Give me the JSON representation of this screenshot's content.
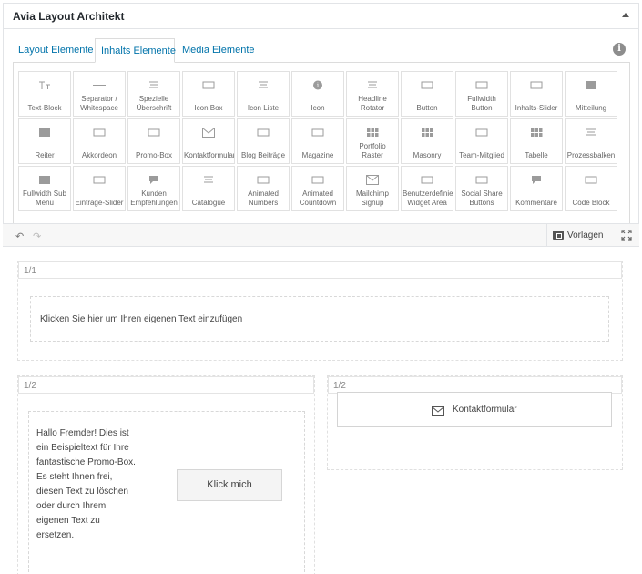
{
  "panel": {
    "title": "Avia Layout Architekt"
  },
  "tabs": [
    {
      "label": "Layout Elemente",
      "active": false
    },
    {
      "label": "Inhalts Elemente",
      "active": true
    },
    {
      "label": "Media Elemente",
      "active": false
    }
  ],
  "elements": [
    {
      "label": "Text-Block",
      "icon": "text-block-icon"
    },
    {
      "label": "Separator / Whitespace",
      "icon": "separator-icon"
    },
    {
      "label": "Spezielle Überschrift",
      "icon": "heading-icon"
    },
    {
      "label": "Icon Box",
      "icon": "icon-box-icon"
    },
    {
      "label": "Icon Liste",
      "icon": "icon-list-icon"
    },
    {
      "label": "Icon",
      "icon": "info-icon"
    },
    {
      "label": "Headline Rotator",
      "icon": "headline-rotator-icon"
    },
    {
      "label": "Button",
      "icon": "button-icon"
    },
    {
      "label": "Fullwidth Button",
      "icon": "fullwidth-button-icon"
    },
    {
      "label": "Inhalts-Slider",
      "icon": "content-slider-icon"
    },
    {
      "label": "Mitteilung",
      "icon": "notification-icon"
    },
    {
      "label": "Reiter",
      "icon": "tabs-icon"
    },
    {
      "label": "Akkordeon",
      "icon": "accordion-icon"
    },
    {
      "label": "Promo-Box",
      "icon": "promo-box-icon"
    },
    {
      "label": "Kontaktformular",
      "icon": "envelope-icon"
    },
    {
      "label": "Blog Beiträge",
      "icon": "blog-posts-icon"
    },
    {
      "label": "Magazine",
      "icon": "magazine-icon"
    },
    {
      "label": "Portfolio Raster",
      "icon": "portfolio-grid-icon"
    },
    {
      "label": "Masonry",
      "icon": "masonry-icon"
    },
    {
      "label": "Team-Mitglied",
      "icon": "team-member-icon"
    },
    {
      "label": "Tabelle",
      "icon": "table-icon"
    },
    {
      "label": "Prozessbalken",
      "icon": "process-bars-icon"
    },
    {
      "label": "Fullwidth Sub Menu",
      "icon": "submenu-icon"
    },
    {
      "label": "Einträge-Slider",
      "icon": "entries-slider-icon"
    },
    {
      "label": "Kunden Empfehlungen",
      "icon": "testimonials-icon"
    },
    {
      "label": "Catalogue",
      "icon": "catalogue-icon"
    },
    {
      "label": "Animated Numbers",
      "icon": "animated-numbers-icon"
    },
    {
      "label": "Animated Countdown",
      "icon": "countdown-icon"
    },
    {
      "label": "Mailchimp Signup",
      "icon": "mail-icon"
    },
    {
      "label": "Benutzerdefinierte Widget Area",
      "icon": "widget-area-icon"
    },
    {
      "label": "Social Share Buttons",
      "icon": "social-share-icon"
    },
    {
      "label": "Kommentare",
      "icon": "comments-icon"
    },
    {
      "label": "Code Block",
      "icon": "code-block-icon"
    }
  ],
  "toolbar": {
    "templates_label": "Vorlagen"
  },
  "builder": {
    "row1": {
      "width_label": "1/1",
      "text": "Klicken Sie hier um Ihren eigenen Text einzufügen"
    },
    "left_col": {
      "width_label": "1/2",
      "promo_text": "Hallo Fremder! Dies ist ein Beispieltext für Ihre fantastische Promo-Box. Es steht Ihnen frei, diesen Text zu löschen oder durch Ihrem eigenen Text zu ersetzen.",
      "button_label": "Klick mich"
    },
    "right_col": {
      "width_label": "1/2",
      "contact_label": "Kontaktformular"
    }
  },
  "colors": {
    "link": "#0073aa",
    "icon": "#9b9b9b",
    "border": "#e1e1e1"
  }
}
